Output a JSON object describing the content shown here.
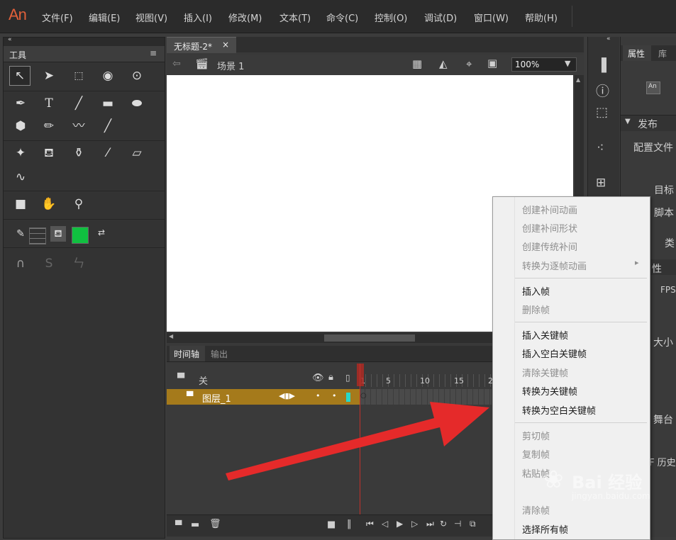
{
  "app": {
    "logo": "An"
  },
  "menubar": [
    "文件(F)",
    "编辑(E)",
    "视图(V)",
    "插入(I)",
    "修改(M)",
    "文本(T)",
    "命令(C)",
    "控制(O)",
    "调试(D)",
    "窗口(W)",
    "帮助(H)"
  ],
  "tools_panel": {
    "title": "工具"
  },
  "document": {
    "tab_title": "无标题-2*",
    "tab_close": "×",
    "scene_label": "场景 1",
    "zoom": "100%"
  },
  "timeline": {
    "tab_timeline": "时间轴",
    "tab_output": "输出",
    "header_label": "关",
    "layer_name": "图层_1",
    "frame_numbers": [
      "1",
      "5",
      "10",
      "15",
      "2"
    ]
  },
  "properties": {
    "tab_props": "属性",
    "tab_lib": "库",
    "doc_icon": "An",
    "publish_header": "发布",
    "profile_label": "配置文件",
    "target_label": "目标",
    "script_label": "脚本",
    "class_label": "类",
    "props_section": "性",
    "fps_label": "FPS",
    "size_label": "大小",
    "stage_label": "舞台",
    "history_label": "F 历史"
  },
  "context_menu": {
    "items": [
      {
        "label": "创建补间动画",
        "enabled": false
      },
      {
        "label": "创建补间形状",
        "enabled": false
      },
      {
        "label": "创建传统补间",
        "enabled": false
      },
      {
        "label": "转换为逐帧动画",
        "enabled": false,
        "submenu": true
      },
      {
        "label": "插入帧",
        "enabled": true
      },
      {
        "label": "删除帧",
        "enabled": false
      },
      {
        "label": "插入关键帧",
        "enabled": true
      },
      {
        "label": "插入空白关键帧",
        "enabled": true
      },
      {
        "label": "清除关键帧",
        "enabled": false
      },
      {
        "label": "转换为关键帧",
        "enabled": true
      },
      {
        "label": "转换为空白关键帧",
        "enabled": true
      },
      {
        "label": "剪切帧",
        "enabled": false
      },
      {
        "label": "复制帧",
        "enabled": false
      },
      {
        "label": "粘贴帧",
        "enabled": false
      },
      {
        "label": "清除帧",
        "enabled": false
      },
      {
        "label": "选择所有帧",
        "enabled": true
      }
    ],
    "submenu_arrow": "▸"
  },
  "watermark": {
    "brand": "Bai 经验",
    "url": "jingyan.baidu.com"
  },
  "colors": {
    "accent_arrow": "#e52a2a",
    "layer_row": "#a57a1b",
    "fill_swatch": "#10c040"
  }
}
